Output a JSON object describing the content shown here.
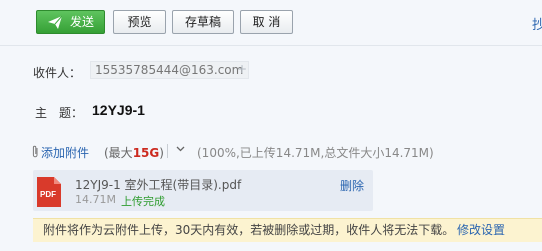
{
  "toolbar": {
    "send_label": "发送",
    "preview_label": "预览",
    "draft_label": "存草稿",
    "cancel_label": "取 消",
    "corner_text": "抄"
  },
  "recipient": {
    "label": "收件人：",
    "address": "15535785444@163.com",
    "add_symbol": "+"
  },
  "subject": {
    "label": "主　题：",
    "value": "12YJ9-1"
  },
  "attachment": {
    "add_label": "添加附件",
    "max_prefix": "(最大",
    "max_size": "15G",
    "max_suffix": ")",
    "upload_info": "(100%,已上传14.71M,总文件大小14.71M)",
    "file": {
      "name": "12YJ9-1 室外工程(带目录).pdf",
      "size": "14.71M",
      "status": "上传完成",
      "delete_label": "删除",
      "icon_text": "PDF"
    }
  },
  "notice": {
    "text": "附件将作为云附件上传，30天内有效，若被删除或过期，收件人将无法下载。",
    "link_label": "修改设置"
  },
  "colors": {
    "send_button": "#3ea83e",
    "link": "#2a65b0",
    "max_size": "#cc2a1f",
    "status_ok": "#2f9c2f",
    "notice_bg": "#fcf3d0"
  }
}
